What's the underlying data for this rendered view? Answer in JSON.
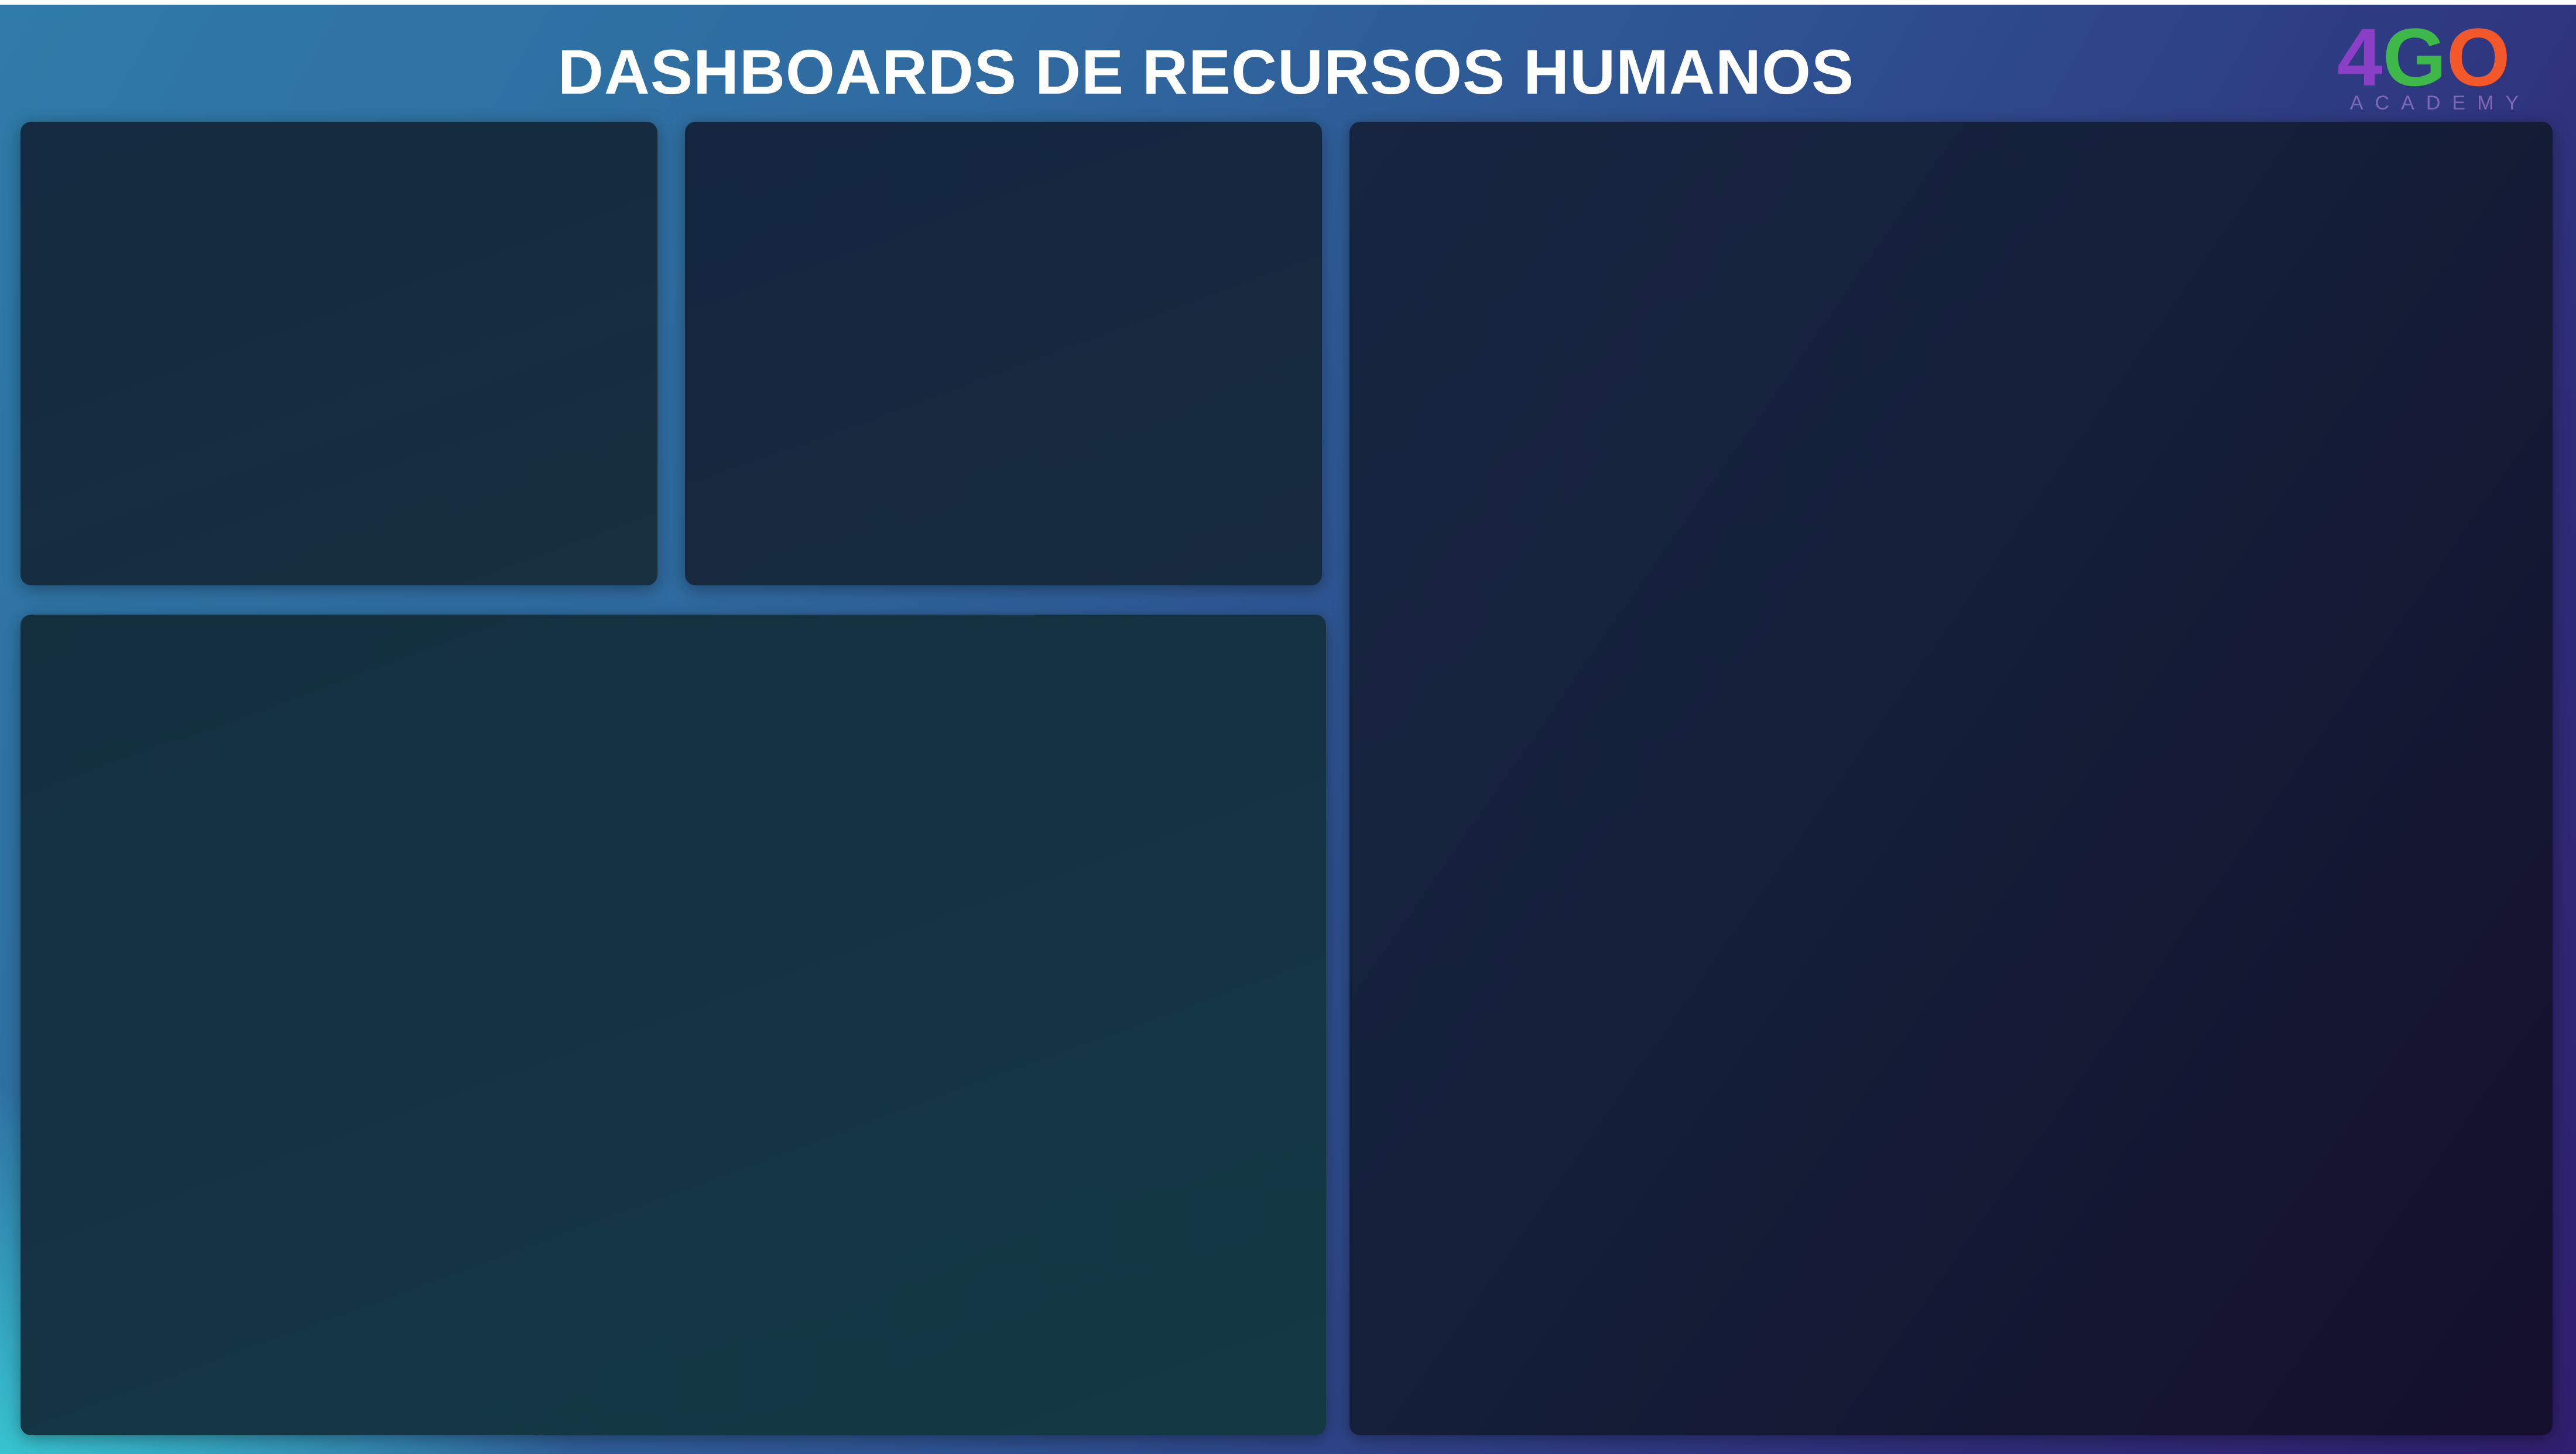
{
  "header": {
    "title": "DASHBOARDS DE RECURSOS HUMANOS"
  },
  "logo": {
    "mark_parts": [
      "4",
      "G",
      "O"
    ],
    "subtitle": "ACADEMY",
    "colors": {
      "part_1": "#8b3fc7",
      "part_2": "#3fb84a",
      "part_3": "#f2582a"
    }
  },
  "theme": {
    "background_start": "#2f7aa8",
    "background_end": "#2f1f6e",
    "corner_glow": "#38c8d2",
    "panel_color": "#142a40"
  }
}
